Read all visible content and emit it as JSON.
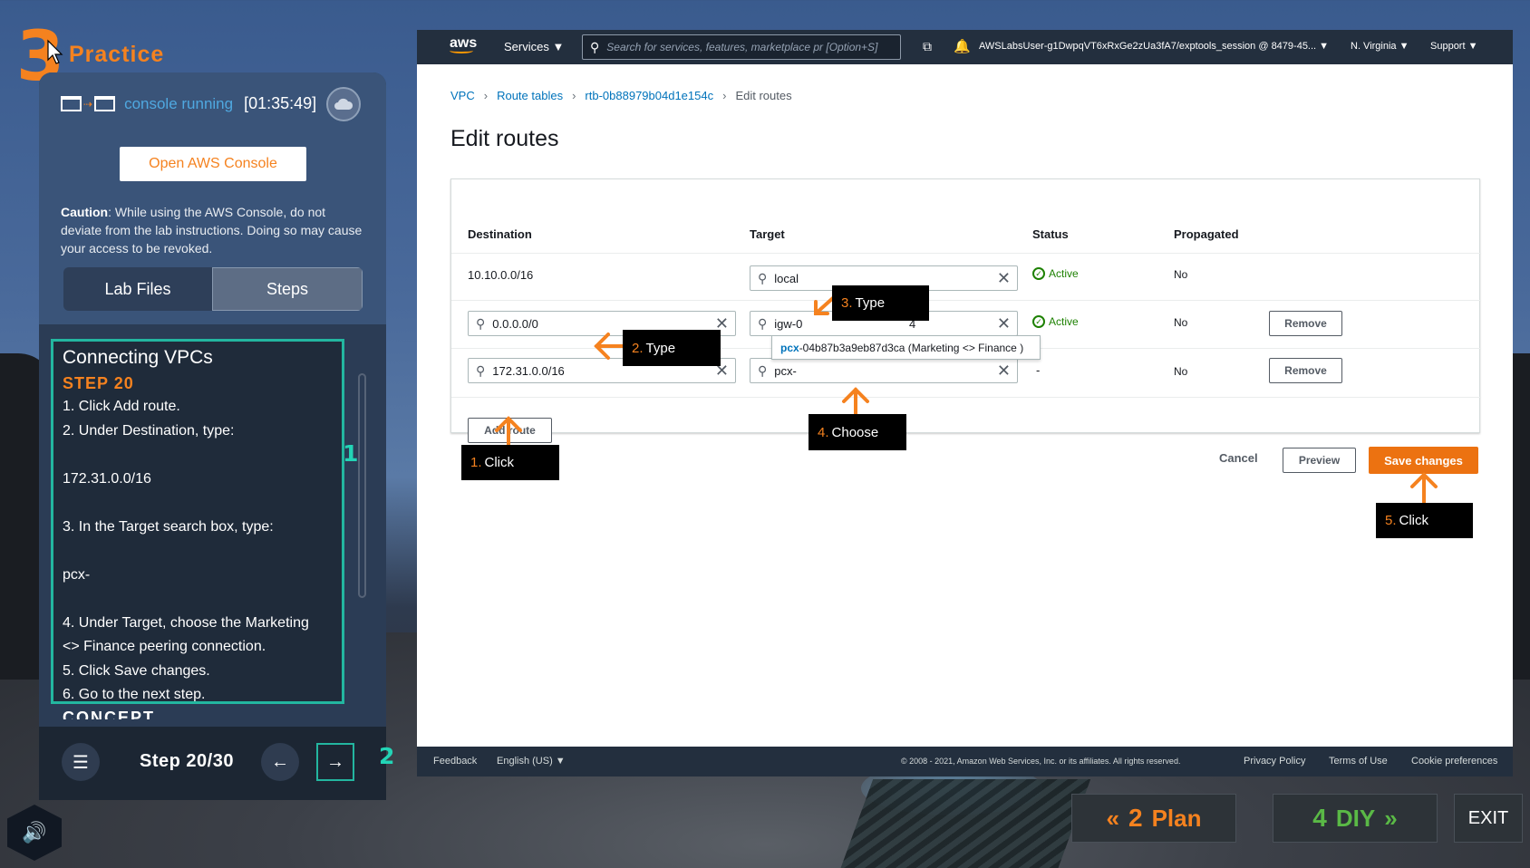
{
  "practice": {
    "number": "3",
    "label": "Practice"
  },
  "console": {
    "status": "console running",
    "timer": "[01:35:49]",
    "open_button": "Open AWS Console",
    "caution_label": "Caution",
    "caution_text": ": While using the AWS Console, do not deviate from the lab instructions. Doing so may cause your access to be revoked."
  },
  "tabs": {
    "lab_files": "Lab Files",
    "steps": "Steps"
  },
  "instructions": {
    "title": "Connecting VPCs",
    "step": "STEP 20",
    "lines": [
      "1. Click Add route.",
      "2. Under Destination, type:",
      "",
      "172.31.0.0/16",
      "",
      "3. In the Target search box, type:",
      "",
      "pcx-",
      "",
      "4. Under Target, choose the Marketing",
      "<> Finance peering connection.",
      "5. Click Save changes.",
      "6. Go to the next step."
    ],
    "next_section": "CONCEPT"
  },
  "nav": {
    "step_counter": "Step 20/30"
  },
  "badges": {
    "one": "1",
    "two": "2"
  },
  "aws": {
    "logo": "aws",
    "services": "Services ▼",
    "search_placeholder": "Search for services, features, marketplace pr [Option+S]",
    "user": "AWSLabsUser-g1DwpqVT6xRxGe2zUa3fA7/exptools_session @ 8479-45... ▼",
    "region": "N. Virginia ▼",
    "support": "Support ▼",
    "breadcrumb": [
      "VPC",
      "Route tables",
      "rtb-0b88979b04d1e154c",
      "Edit routes"
    ],
    "page_title": "Edit routes",
    "columns": [
      "Destination",
      "Target",
      "Status",
      "Propagated"
    ],
    "rows": [
      {
        "destination": "10.10.0.0/16",
        "target": "local",
        "status": "Active",
        "propagated": "No"
      },
      {
        "destination": "0.0.0.0/0",
        "target": "igw-0",
        "target_tail": "4",
        "status": "Active",
        "propagated": "No",
        "remove": "Remove"
      },
      {
        "destination": "172.31.0.0/16",
        "target": "pcx-",
        "status": "-",
        "propagated": "No",
        "remove": "Remove"
      }
    ],
    "dropdown_option_hl": "pcx",
    "dropdown_option_rest": "-04b87b3a9eb87d3ca (Marketing <> Finance )",
    "add_route": "Add route",
    "cancel": "Cancel",
    "preview": "Preview",
    "save": "Save changes",
    "footer": {
      "feedback": "Feedback",
      "language": "English (US) ▼",
      "copyright": "© 2008 - 2021, Amazon Web Services, Inc. or its affiliates. All rights reserved.",
      "privacy": "Privacy Policy",
      "terms": "Terms of Use",
      "cookies": "Cookie preferences"
    }
  },
  "annotations": {
    "click1": {
      "n": "1.",
      "t": "Click"
    },
    "type2": {
      "n": "2.",
      "t": "Type"
    },
    "type3": {
      "n": "3.",
      "t": "Type"
    },
    "choose4": {
      "n": "4.",
      "t": "Choose"
    },
    "click5": {
      "n": "5.",
      "t": "Click"
    }
  },
  "bottom": {
    "plan_num": "2",
    "plan": "Plan",
    "diy_num": "4",
    "diy": "DIY",
    "exit": "EXIT"
  },
  "colors": {
    "accent_orange": "#f5821f",
    "teal": "#23b6a0",
    "aws_nav": "#232f3e",
    "save_orange": "#ec7211"
  }
}
